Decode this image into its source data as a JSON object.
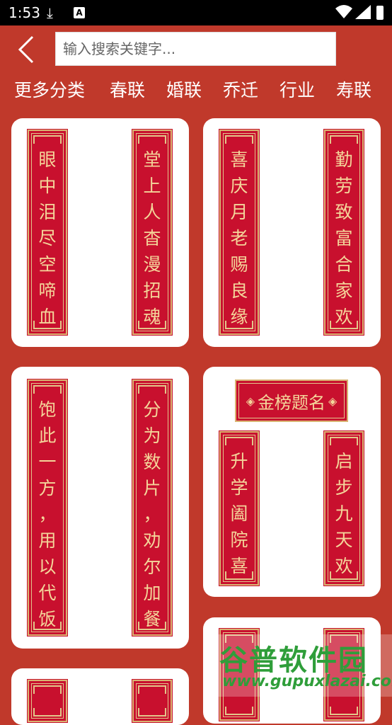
{
  "status": {
    "time": "1:53"
  },
  "search": {
    "placeholder": "输入搜索关键字..."
  },
  "categories": [
    "更多分类",
    "春联",
    "婚联",
    "乔迁",
    "行业",
    "寿联"
  ],
  "cards": [
    {
      "left": "眼中泪尽空啼血",
      "right": "堂上人杳漫招魂"
    },
    {
      "left": "喜庆月老赐良缘",
      "right": "勤劳致富合家欢"
    },
    {
      "left": "饱此一方，用以代饭",
      "right": "分为数片，劝尔加餐"
    },
    {
      "banner": "金榜题名",
      "left": "升学阖院喜",
      "right": "启步九天欢"
    }
  ],
  "watermark": {
    "title": "谷普软件园",
    "url": "www.gupuxlazai.com"
  },
  "colors": {
    "background": "#c0392b",
    "couplet": "#c8102e",
    "gold": "#f4d59a"
  }
}
